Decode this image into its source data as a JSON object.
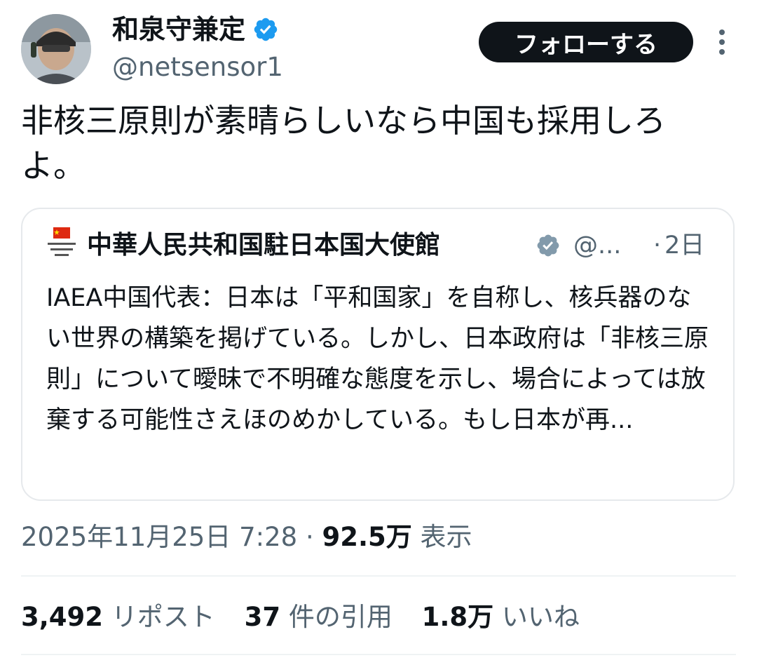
{
  "author": {
    "display_name": "和泉守兼定",
    "handle": "@netsensor1",
    "verified_color": "#1d9bf0"
  },
  "follow_button": {
    "label": "フォローする"
  },
  "more_icon": "more-vertical-icon",
  "tweet": {
    "text": "非核三原則が素晴らしいなら中国も採用しろよ。"
  },
  "quote": {
    "avatar_icon": "chinese-flag-logo",
    "display_name": "中華人民共和国駐日本国大使館",
    "verified_color": "#829aab",
    "handle": "@...",
    "separator": "·",
    "time": "2日",
    "text": "IAEA中国代表：日本は「平和国家」を自称し、核兵器のない世界の構築を掲げている。しかし、日本政府は「非核三原則」について曖昧で不明確な態度を示し、場合によっては放棄する可能性さえほのめかしている。もし日本が再..."
  },
  "meta": {
    "timestamp": "2025年11月25日 7:28",
    "separator": "·",
    "views_count": "92.5万",
    "views_label": "表示"
  },
  "stats": {
    "reposts_count": "3,492",
    "reposts_label": "リポスト",
    "quotes_count": "37",
    "quotes_label": "件の引用",
    "likes_count": "1.8万",
    "likes_label": "いいね"
  }
}
